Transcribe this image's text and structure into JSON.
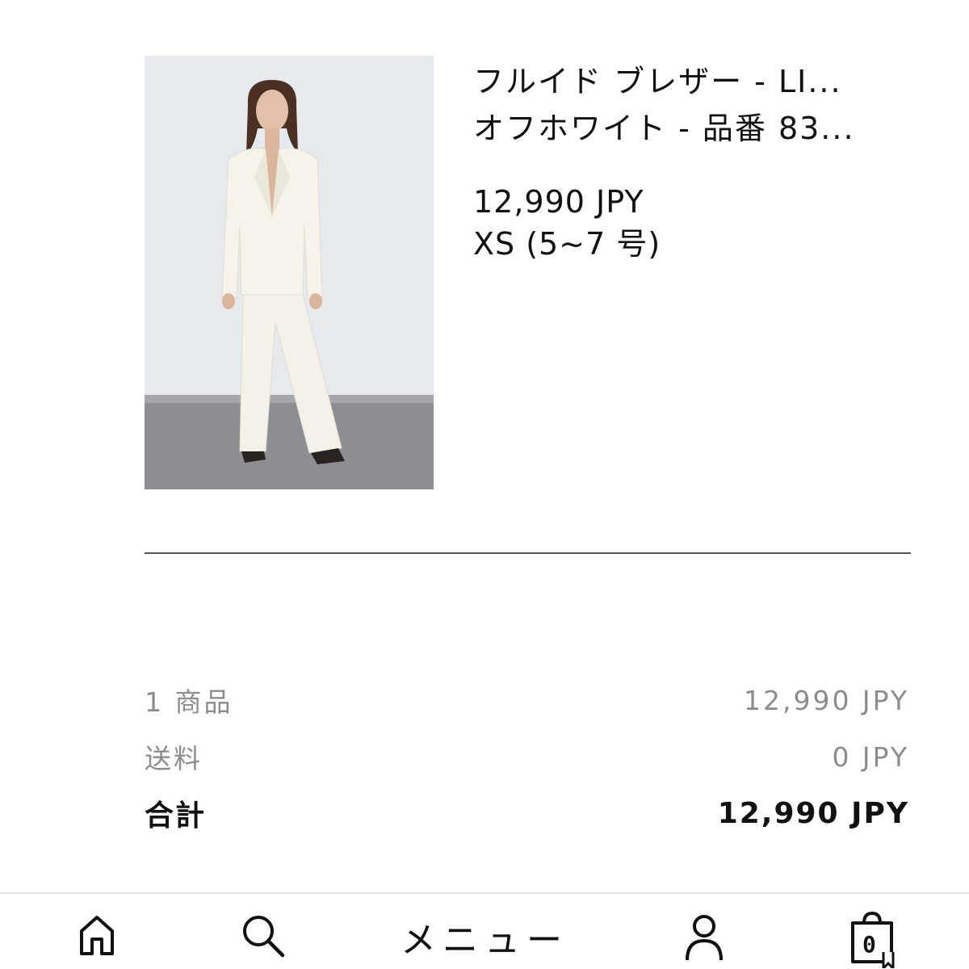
{
  "product": {
    "name_line1": "フルイド ブレザー - LI...",
    "name_line2": "オフホワイト - 品番 83...",
    "price": "12,990 JPY",
    "size": "XS (5~7 号)"
  },
  "summary": {
    "items_label": "1 商品",
    "items_value": "12,990 JPY",
    "shipping_label": "送料",
    "shipping_value": "0 JPY",
    "total_label": "合計",
    "total_value": "12,990 JPY"
  },
  "nav": {
    "home_icon": "home-icon",
    "search_icon": "search-icon",
    "menu_label": "メニュー",
    "account_icon": "user-icon",
    "cart_icon": "shopping-bag-icon",
    "cart_count": "0"
  }
}
